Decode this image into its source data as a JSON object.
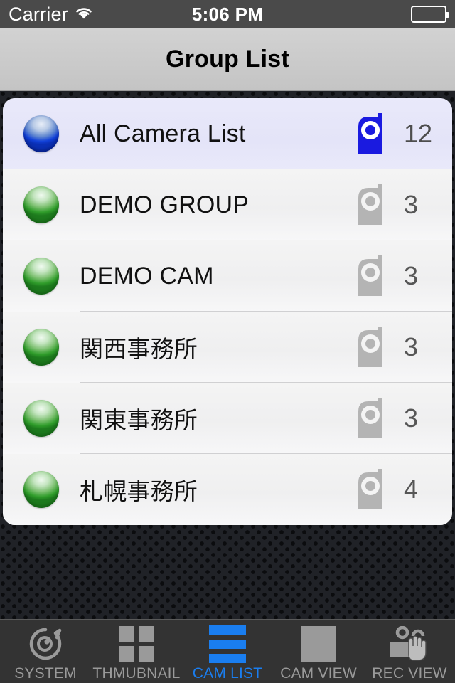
{
  "status_bar": {
    "carrier": "Carrier",
    "wifi_icon": "wifi-icon",
    "time": "5:06 PM",
    "battery_icon": "battery-icon"
  },
  "nav_bar": {
    "title": "Group List"
  },
  "list": {
    "rows": [
      {
        "orb_color": "blue",
        "orb_state": "all",
        "label": "All Camera List",
        "camera_icon": "camera-icon",
        "camera_icon_color": "#1a1ae0",
        "count": "12",
        "selected": true
      },
      {
        "orb_color": "green",
        "orb_state": "online",
        "label": "DEMO GROUP",
        "camera_icon": "camera-icon",
        "camera_icon_color": "#b4b4b4",
        "count": "3",
        "selected": false
      },
      {
        "orb_color": "green",
        "orb_state": "online",
        "label": "DEMO CAM",
        "camera_icon": "camera-icon",
        "camera_icon_color": "#b4b4b4",
        "count": "3",
        "selected": false
      },
      {
        "orb_color": "green",
        "orb_state": "online",
        "label": "関西事務所",
        "camera_icon": "camera-icon",
        "camera_icon_color": "#b4b4b4",
        "count": "3",
        "selected": false
      },
      {
        "orb_color": "green",
        "orb_state": "online",
        "label": "関東事務所",
        "camera_icon": "camera-icon",
        "camera_icon_color": "#b4b4b4",
        "count": "3",
        "selected": false
      },
      {
        "orb_color": "green",
        "orb_state": "online",
        "label": "札幌事務所",
        "camera_icon": "camera-icon",
        "camera_icon_color": "#b4b4b4",
        "count": "4",
        "selected": false
      }
    ]
  },
  "tab_bar": {
    "active_color": "#1a7ef0",
    "inactive_color": "#9a9a9a",
    "tabs": [
      {
        "label": "SYSTEM",
        "icon": "system-dial-icon",
        "active": false
      },
      {
        "label": "THMUBNAIL",
        "icon": "grid-squares-icon",
        "active": false
      },
      {
        "label": "CAM LIST",
        "icon": "list-bars-icon",
        "active": true
      },
      {
        "label": "CAM VIEW",
        "icon": "solid-square-icon",
        "active": false
      },
      {
        "label": "REC VIEW",
        "icon": "camcorder-hand-icon",
        "active": false
      }
    ]
  }
}
